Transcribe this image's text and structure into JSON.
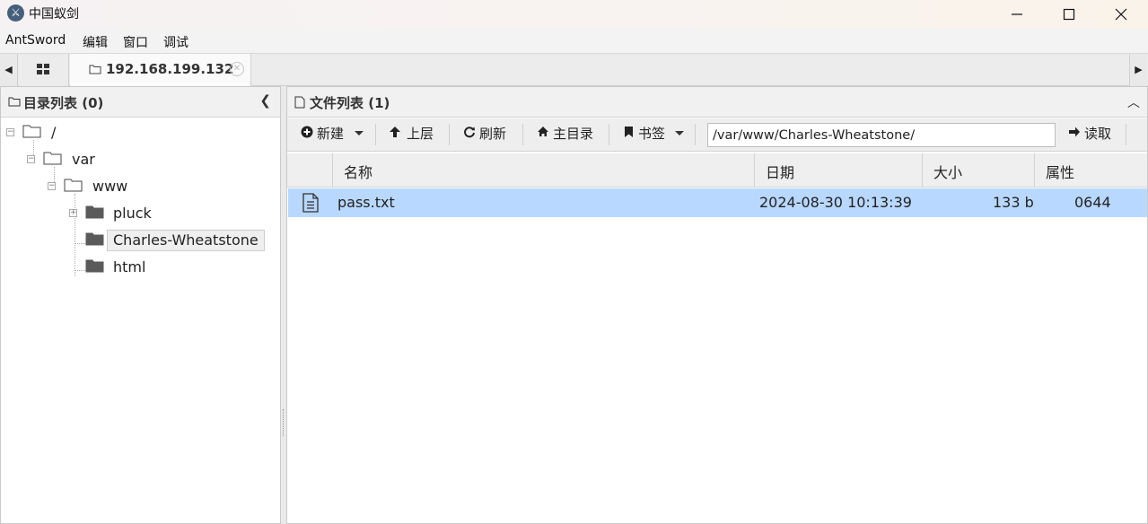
{
  "window": {
    "title": "中国蚁剑",
    "icon": "antsword-logo-icon"
  },
  "menu": [
    "AntSword",
    "编辑",
    "窗口",
    "调试"
  ],
  "tabs": {
    "home_icon": "grid-icon",
    "active_tab_label": "192.168.199.132"
  },
  "left_panel": {
    "title": "目录列表 (0)",
    "tree": [
      {
        "label": "/",
        "expanded": true
      },
      {
        "label": "var",
        "expanded": true
      },
      {
        "label": "www",
        "expanded": true
      },
      {
        "label": "pluck",
        "expanded": false
      },
      {
        "label": "Charles-Wheatstone",
        "selected": true
      },
      {
        "label": "html"
      }
    ]
  },
  "right_panel": {
    "title": "文件列表 (1)",
    "toolbar": {
      "new_label": "新建",
      "up_label": "上层",
      "refresh_label": "刷新",
      "home_label": "主目录",
      "bookmark_label": "书签",
      "path_value": "/var/www/Charles-Wheatstone/",
      "read_label": "读取"
    },
    "columns": [
      "名称",
      "日期",
      "大小",
      "属性"
    ],
    "files": [
      {
        "name": "pass.txt",
        "date": "2024-08-30 10:13:39",
        "size": "133 b",
        "perm": "0644",
        "icon": "text-file-icon"
      }
    ]
  },
  "colors": {
    "selected_row": "#b8d8ff",
    "folder_closed": "#5a5a5a"
  }
}
